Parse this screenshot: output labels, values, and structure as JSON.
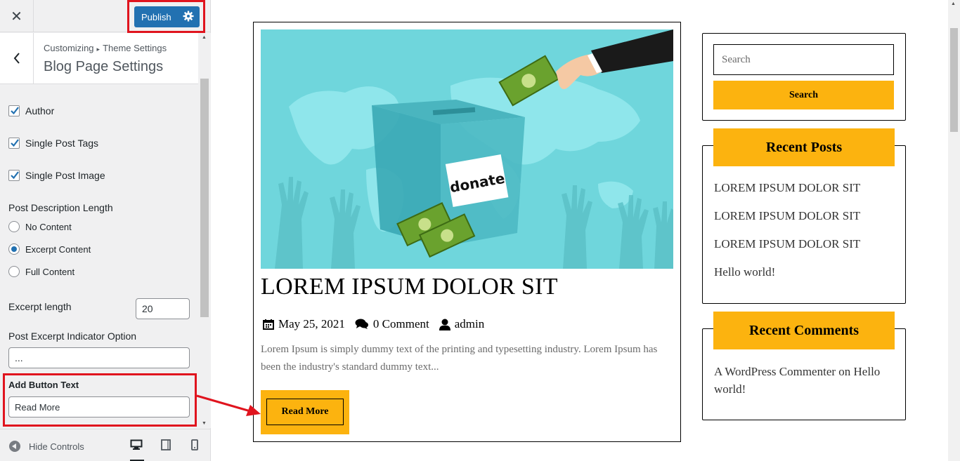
{
  "colors": {
    "accent": "#fcb30f",
    "publish": "#2271b1",
    "highlight": "#e0141e"
  },
  "topbar": {
    "close_icon": "close-icon",
    "publish_label": "Publish",
    "settings_icon": "gear-icon"
  },
  "section": {
    "breadcrumb_root": "Customizing",
    "breadcrumb_parent": "Theme Settings",
    "title": "Blog Page Settings"
  },
  "controls": {
    "checkboxes": [
      {
        "label": "Author",
        "checked": true
      },
      {
        "label": "Single Post Tags",
        "checked": true
      },
      {
        "label": "Single Post Image",
        "checked": true
      }
    ],
    "desc_length_label": "Post Description Length",
    "radios": [
      {
        "label": "No Content",
        "selected": false
      },
      {
        "label": "Excerpt Content",
        "selected": true
      },
      {
        "label": "Full Content",
        "selected": false
      }
    ],
    "excerpt_length_label": "Excerpt length",
    "excerpt_length_value": "20",
    "indicator_label": "Post Excerpt Indicator Option",
    "indicator_value": "...",
    "button_text_label": "Add Button Text",
    "button_text_value": "Read More"
  },
  "footer": {
    "hide_controls": "Hide Controls",
    "devices": [
      "desktop-icon",
      "tablet-icon",
      "mobile-icon"
    ]
  },
  "post": {
    "image_text": "donate",
    "title": "LOREM IPSUM DOLOR SIT",
    "date": "May 25, 2021",
    "comments": "0 Comment",
    "author": "admin",
    "excerpt": "Lorem Ipsum is simply dummy text of the printing and typesetting industry. Lorem Ipsum has been the industry's standard dummy text...",
    "read_more": "Read More"
  },
  "sidebar": {
    "search_placeholder": "Search",
    "search_button": "Search",
    "recent_posts_title": "Recent Posts",
    "recent_posts": [
      "LOREM IPSUM DOLOR SIT",
      "LOREM IPSUM DOLOR SIT",
      "LOREM IPSUM DOLOR SIT",
      "Hello world!"
    ],
    "recent_comments_title": "Recent Comments",
    "recent_comment": "A WordPress Commenter on Hello world!"
  }
}
